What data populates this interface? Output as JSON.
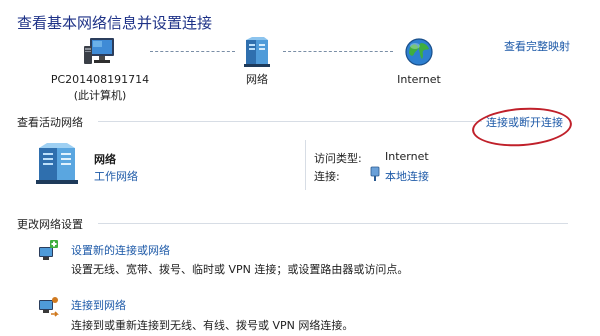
{
  "page": {
    "title": "查看基本网络信息并设置连接",
    "full_map_link": "查看完整映射"
  },
  "map": {
    "computer": {
      "name": "PC201408191714",
      "subtitle": "(此计算机)"
    },
    "network": {
      "name": "网络"
    },
    "internet": {
      "name": "Internet"
    }
  },
  "active": {
    "header": "查看活动网络",
    "connect_link": "连接或断开连接",
    "network_name": "网络",
    "network_type": "工作网络",
    "access_type_label": "访问类型:",
    "access_type_value": "Internet",
    "connection_label": "连接:",
    "connection_value": "本地连接"
  },
  "change": {
    "header": "更改网络设置",
    "items": [
      {
        "title": "设置新的连接或网络",
        "desc": "设置无线、宽带、拨号、临时或 VPN 连接；或设置路由器或访问点。"
      },
      {
        "title": "连接到网络",
        "desc": "连接到或重新连接到无线、有线、拨号或 VPN 网络连接。"
      }
    ]
  },
  "colors": {
    "title": "#1e3287",
    "link": "#1e5aa8",
    "highlight_oval": "#c0202a"
  }
}
